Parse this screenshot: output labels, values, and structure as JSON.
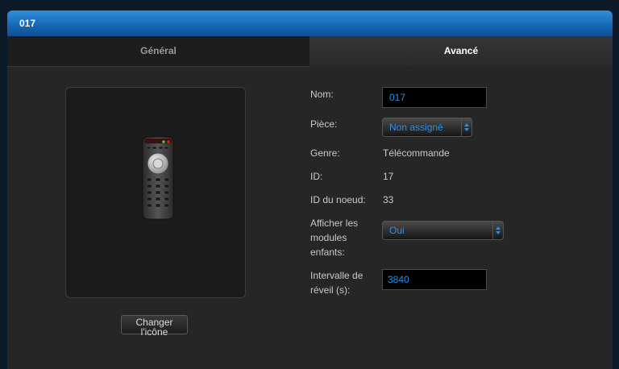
{
  "window": {
    "title": "017"
  },
  "tabs": [
    {
      "label": "Général",
      "active": false
    },
    {
      "label": "Avancé",
      "active": true
    }
  ],
  "icon": {
    "name": "remote-control-icon",
    "change_button": "Changer\nl'icône"
  },
  "form": {
    "nom": {
      "label": "Nom:",
      "value": "017"
    },
    "piece": {
      "label": "Pièce:",
      "value": "Non assigné"
    },
    "genre": {
      "label": "Genre:",
      "value": "Télécommande"
    },
    "id": {
      "label": "ID:",
      "value": "17"
    },
    "id_noeud": {
      "label": "ID du noeud:",
      "value": "33"
    },
    "afficher": {
      "label": "Afficher les\nmodules\nenfants:",
      "value": "Oui"
    },
    "intervalle": {
      "label": "Intervalle de\nréveil (s):",
      "value": "3840"
    }
  },
  "colors": {
    "accent": "#2e8fe6",
    "titlebar": "#1565b2"
  }
}
